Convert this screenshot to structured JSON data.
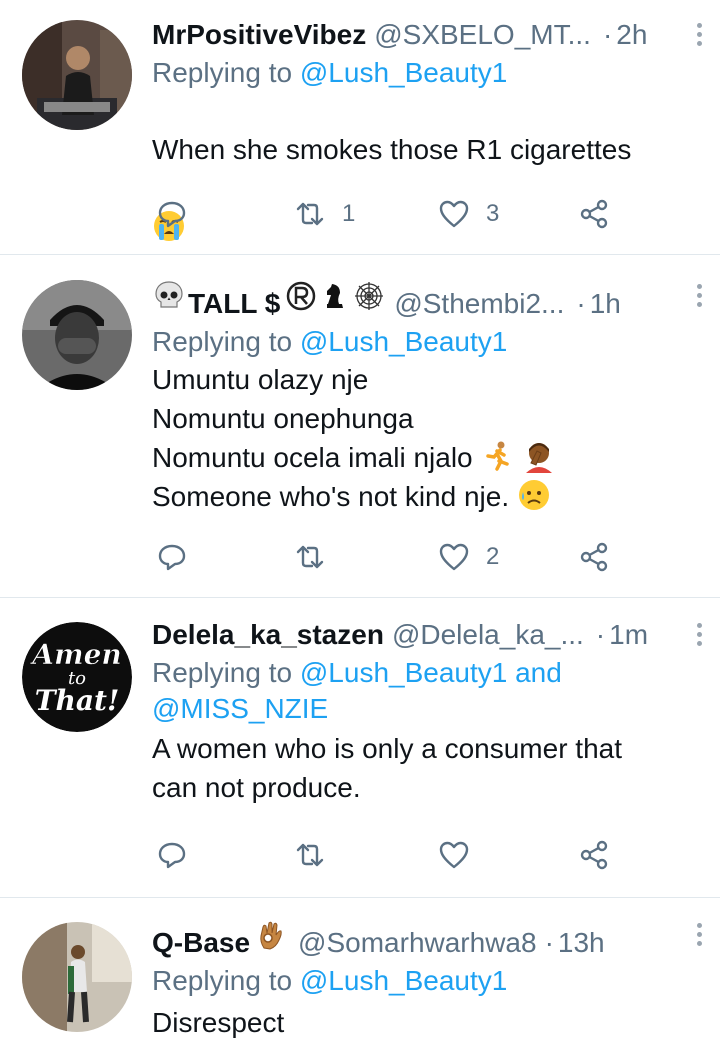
{
  "tweets": [
    {
      "name": "MrPositiveVibez",
      "handle": "@SXBELO_MT...",
      "time": "2h",
      "replying_label": "Replying to",
      "mentions": "@Lush_Beauty1",
      "text": "When she smokes those R1 cigarettes",
      "emoji": "crying-face",
      "replies": "",
      "retweets": "1",
      "likes": "3"
    },
    {
      "name": "TALL $",
      "name_emoji": [
        "skull",
        "registered",
        "chess-knight",
        "spider-web"
      ],
      "handle": "@Sthembi2...",
      "time": "1h",
      "replying_label": "Replying to",
      "mentions": "@Lush_Beauty1",
      "lines": [
        "Umuntu olazy nje",
        "Nomuntu onephunga",
        "Nomuntu ocela imali njalo",
        "Someone who's not kind nje."
      ],
      "replies": "",
      "retweets": "",
      "likes": "2"
    },
    {
      "name": "Delela_ka_stazen",
      "handle": "@Delela_ka_...",
      "time": "1m",
      "avatar_text": [
        "Amen",
        "to",
        "That!"
      ],
      "replying_label": "Replying to",
      "mentions": "@Lush_Beauty1 and",
      "mentions2": "@MISS_NZIE",
      "text": "A women who is only a consumer that\ncan not produce.",
      "replies": "",
      "retweets": "",
      "likes": ""
    },
    {
      "name": "Q-Base",
      "handle": "@Somarhwarhwa8",
      "time": "13h",
      "replying_label": "Replying to",
      "mentions": "@Lush_Beauty1",
      "text": "Disrespect"
    }
  ],
  "colors": {
    "accent": "#1da1f2",
    "muted": "#5b7083",
    "divider": "#e1e8ed"
  }
}
